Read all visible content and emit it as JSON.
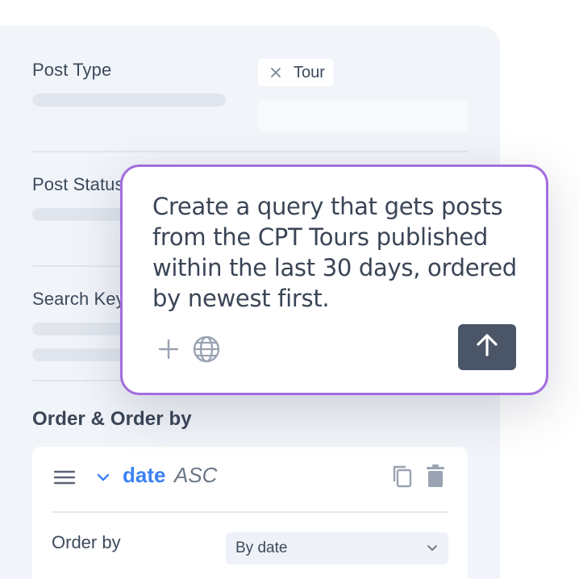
{
  "filters": {
    "post_type_label": "Post Type",
    "post_type_chip": "Tour",
    "post_status_label": "Post Status",
    "search_keyword_label": "Search Keyword"
  },
  "order": {
    "section_title": "Order & Order by",
    "field": "date",
    "direction": "ASC",
    "order_by_label": "Order by",
    "order_by_value": "By date"
  },
  "prompt": {
    "text": "Create a query that gets posts from the CPT Tours published within the last 30 days, ordered by newest first."
  },
  "icons": {
    "chip_remove": "close-icon",
    "drag": "drag-handle-icon",
    "collapse": "chevron-down-icon",
    "duplicate": "copy-icon",
    "delete": "trash-icon",
    "attach": "plus-icon",
    "web": "globe-icon",
    "send": "arrow-up-icon",
    "dropdown": "chevron-down-icon"
  },
  "colors": {
    "panel": "#f1f4f9",
    "accent_blue": "#3b82f6",
    "prompt_border": "#a26ee0",
    "send_button": "#4b5568"
  }
}
